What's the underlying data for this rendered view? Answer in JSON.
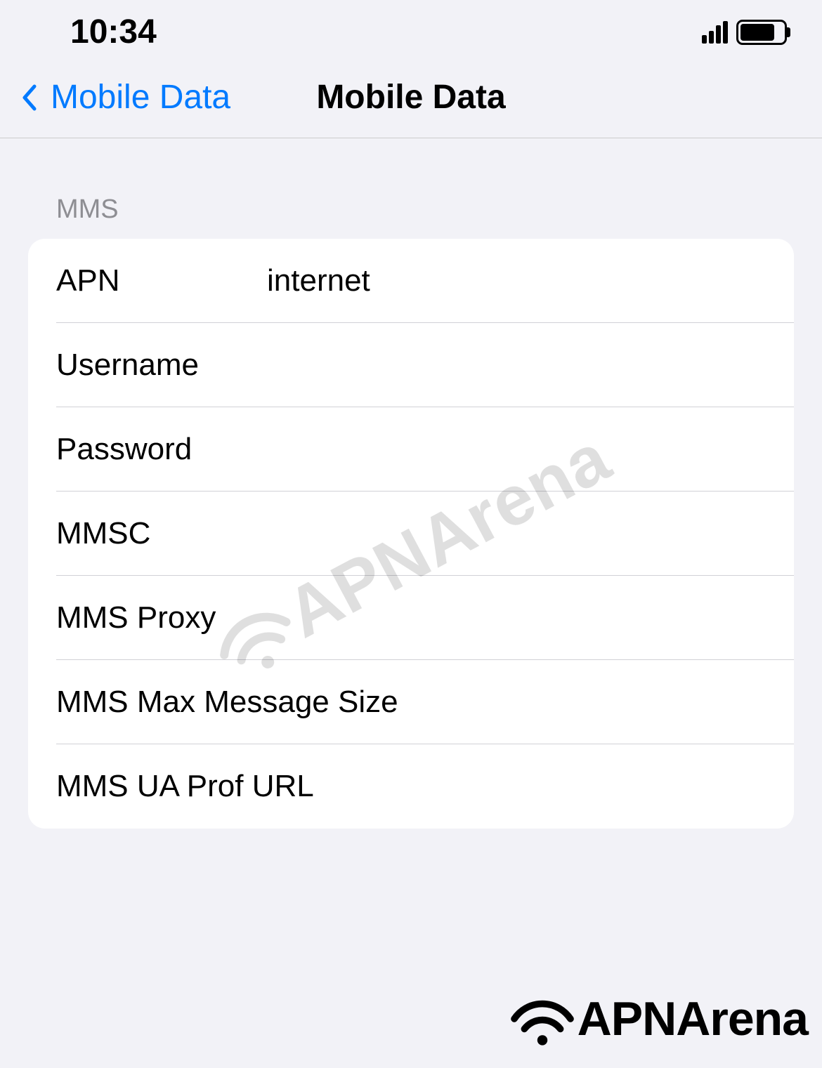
{
  "statusbar": {
    "time": "10:34"
  },
  "nav": {
    "back_label": "Mobile Data",
    "title": "Mobile Data"
  },
  "section": {
    "header": "MMS",
    "rows": [
      {
        "label": "APN",
        "value": "internet"
      },
      {
        "label": "Username",
        "value": ""
      },
      {
        "label": "Password",
        "value": ""
      },
      {
        "label": "MMSC",
        "value": ""
      },
      {
        "label": "MMS Proxy",
        "value": ""
      },
      {
        "label": "MMS Max Message Size",
        "value": ""
      },
      {
        "label": "MMS UA Prof URL",
        "value": ""
      }
    ]
  },
  "branding": {
    "name": "APNArena"
  }
}
